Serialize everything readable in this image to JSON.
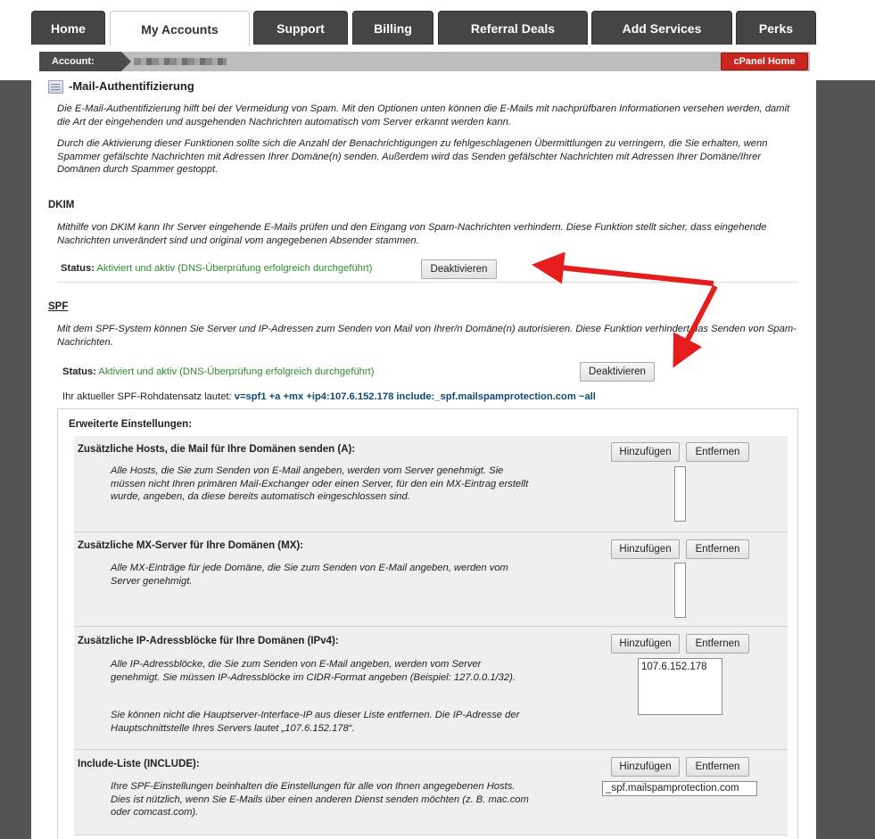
{
  "tabs": [
    "Home",
    "My Accounts",
    "Support",
    "Billing",
    "Referral Deals",
    "Add Services",
    "Perks"
  ],
  "account": {
    "label": "Account:",
    "cpanel_button": "cPanel Home"
  },
  "page": {
    "title": "-Mail-Authentifizierung",
    "intro1": "Die E-Mail-Authentifizierung hilft bei der Vermeidung von Spam. Mit den Optionen unten können die E-Mails mit nachprüfbaren Informationen versehen werden, damit die Art der eingehenden und ausgehenden Nachrichten automatisch vom Server erkannt werden kann.",
    "intro2": "Durch die Aktivierung dieser Funktionen sollte sich die Anzahl der Benachrichtigungen zu fehlgeschlagenen Übermittlungen zu verringern, die Sie erhalten, wenn Spammer gefälschte Nachrichten mit Adressen Ihrer Domäne(n) senden. Außerdem wird das Senden gefälschter Nachrichten mit Adressen Ihrer Domäne/Ihrer Domänen durch Spammer gestoppt."
  },
  "dkim": {
    "title": "DKIM",
    "desc": "Mithilfe von DKIM kann Ihr Server eingehende E-Mails prüfen und den Eingang von Spam-Nachrichten verhindern. Diese Funktion stellt sicher, dass eingehende Nachrichten unverändert sind und original vom angegebenen Absender stammen.",
    "status_label": "Status:",
    "status_value": "Aktiviert und aktiv (DNS-Überprüfung erfolgreich durchgeführt)",
    "button": "Deaktivieren"
  },
  "spf": {
    "title": "SPF",
    "desc": "Mit dem SPF-System können Sie Server und IP-Adressen zum Senden von Mail von Ihrer/n Domäne(n) autorisieren. Diese Funktion verhindert das Senden von Spam-Nachrichten.",
    "status_label": "Status:",
    "status_value": "Aktiviert und aktiv (DNS-Überprüfung erfolgreich durchgeführt)",
    "button": "Deaktivieren",
    "record_label": "Ihr aktueller SPF-Rohdatensatz lautet:",
    "record_value": "v=spf1 +a +mx +ip4:107.6.152.178 include:_spf.mailspamprotection.com ~all"
  },
  "advanced": {
    "title": "Erweiterte Einstellungen:",
    "add_label": "Hinzufügen",
    "remove_label": "Entfernen",
    "hosts": {
      "title": "Zusätzliche Hosts, die Mail für Ihre Domänen senden (A):",
      "desc": "Alle Hosts, die Sie zum Senden von E-Mail angeben, werden vom Server genehmigt. Sie müssen nicht Ihren primären Mail-Exchanger oder einen Server, für den ein MX-Eintrag erstellt wurde, angeben, da diese bereits automatisch eingeschlossen sind."
    },
    "mx": {
      "title": "Zusätzliche MX-Server für Ihre Domänen (MX):",
      "desc": "Alle MX-Einträge für jede Domäne, die Sie zum Senden von E-Mail angeben, werden vom Server genehmigt."
    },
    "ipv4": {
      "title": "Zusätzliche IP-Adressblöcke für Ihre Domänen (IPv4):",
      "desc1": "Alle IP-Adressblöcke, die Sie zum Senden von E-Mail angeben, werden vom Server genehmigt. Sie müssen IP-Adressblöcke im CIDR-Format angeben (Beispiel: 127.0.0.1/32).",
      "desc2": "Sie können nicht die Hauptserver-Interface-IP aus dieser Liste entfernen. Die IP-Adresse der Hauptschnittstelle Ihres Servers lautet „107.6.152.178“.",
      "entry": "107.6.152.178"
    },
    "include": {
      "title": "Include-Liste (INCLUDE):",
      "desc": "Ihre SPF-Einstellungen beinhalten die Einstellungen für alle von Ihnen angegebenen Hosts. Dies ist nützlich, wenn Sie E-Mails über einen anderen Dienst senden möchten (z. B. mac.com oder comcast.com).",
      "value": "_spf.mailspamprotection.com"
    }
  }
}
